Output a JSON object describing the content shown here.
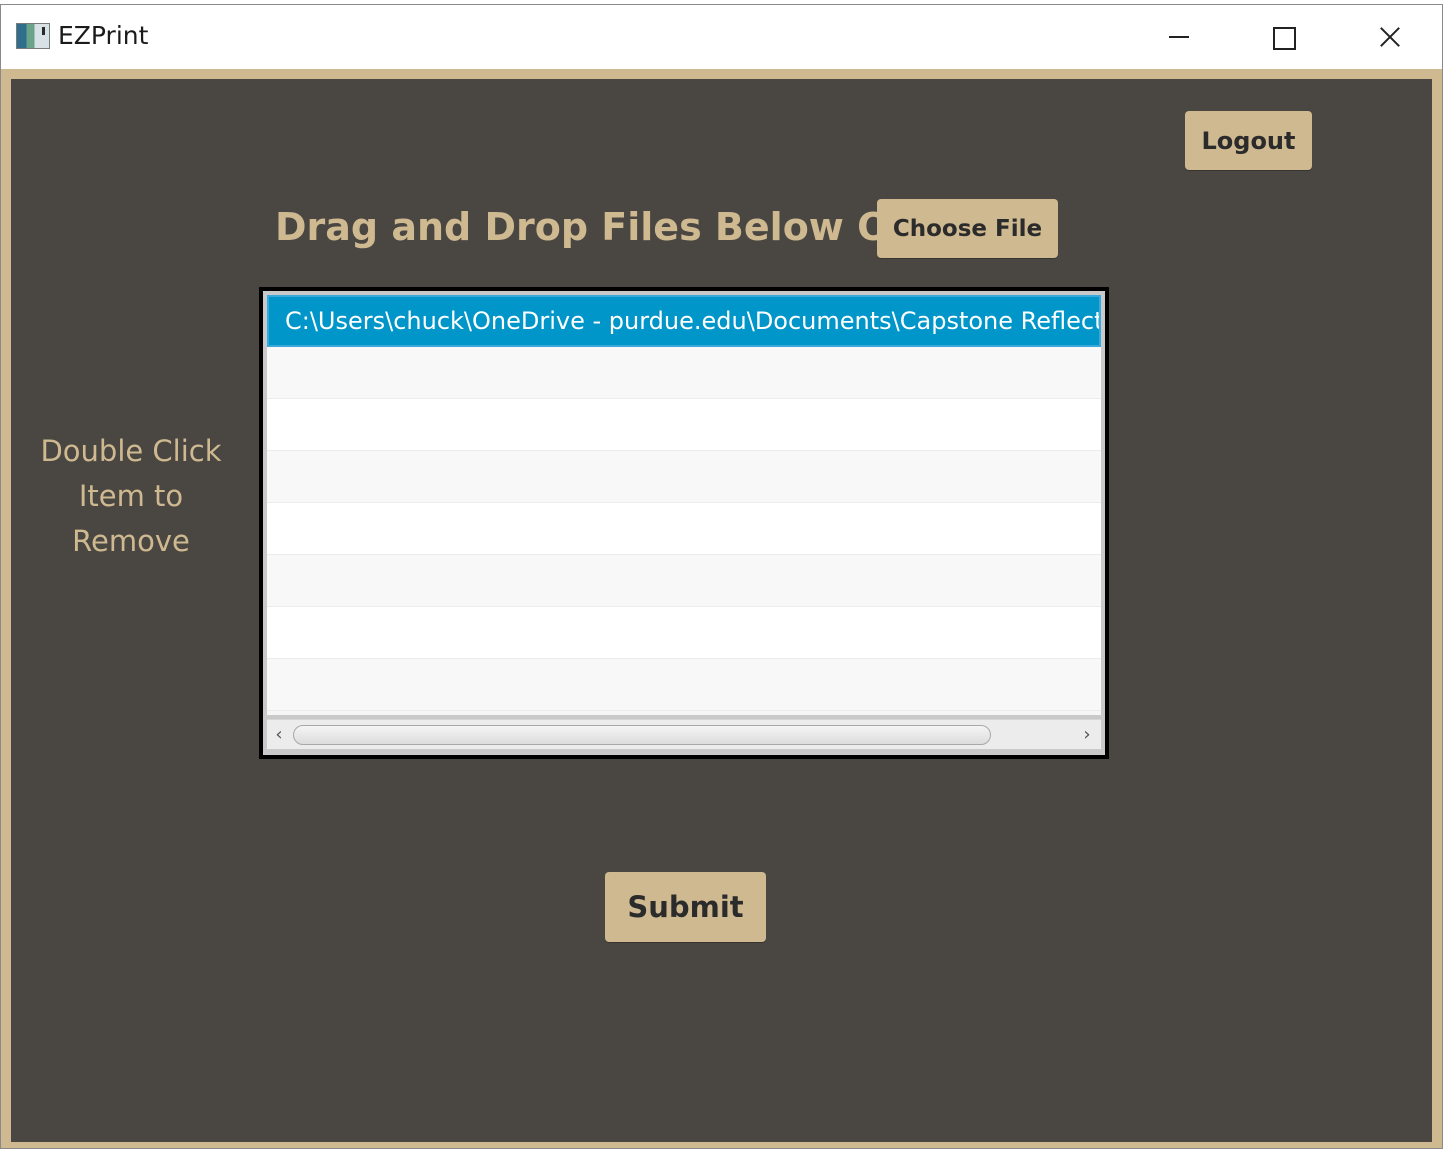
{
  "window": {
    "title": "EZPrint",
    "app_icon": "ezprint-app-icon",
    "controls": {
      "minimize_icon": "minimize-icon",
      "maximize_icon": "maximize-icon",
      "close_icon": "close-icon"
    }
  },
  "colors": {
    "accent": "#cfb991",
    "background": "#4a4742",
    "selection": "#0096c9"
  },
  "header": {
    "logout_label": "Logout",
    "heading": "Drag and Drop Files Below Or",
    "choose_file_label": "Choose File"
  },
  "hint": {
    "line1": "Double Click",
    "line2": "Item to",
    "line3": "Remove"
  },
  "file_list": {
    "items": [
      "C:\\Users\\chuck\\OneDrive - purdue.edu\\Documents\\Capstone Reflection"
    ],
    "selected_index": 0
  },
  "footer": {
    "submit_label": "Submit"
  }
}
